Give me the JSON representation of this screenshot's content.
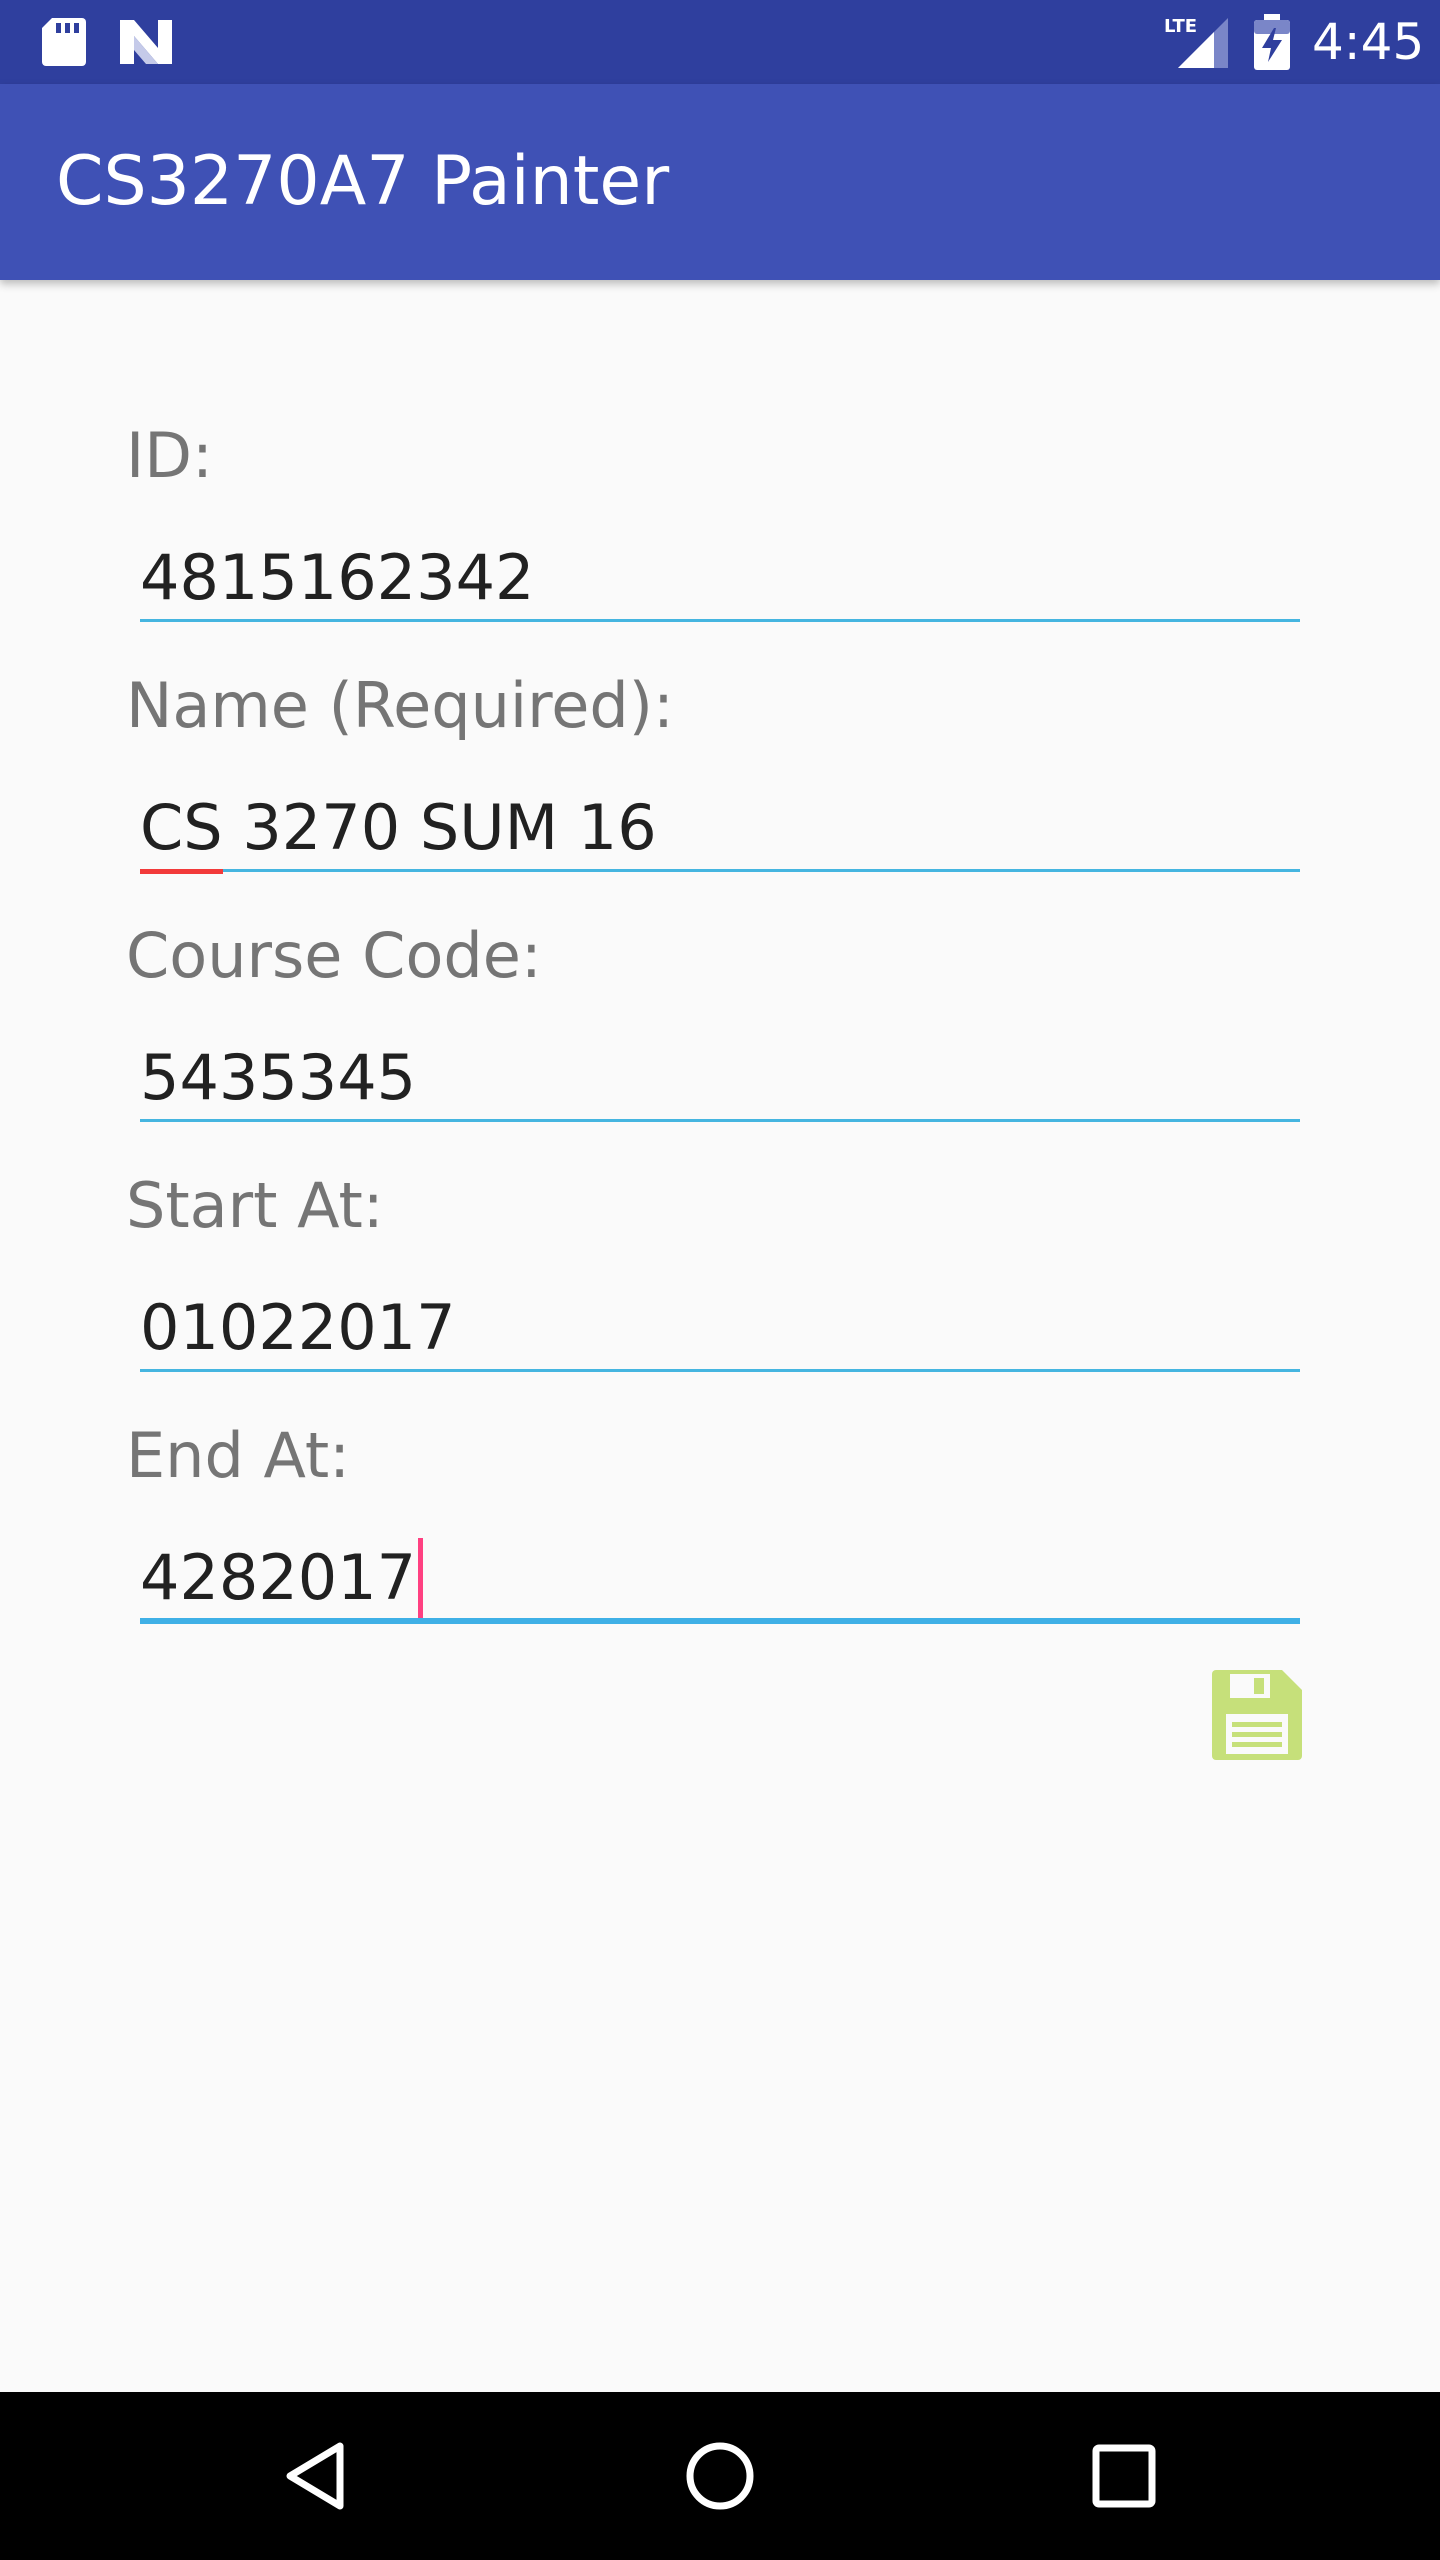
{
  "status_bar": {
    "time": "4:45",
    "left_icons": [
      "sd-card-icon",
      "n-logo-icon"
    ],
    "right_icons": [
      "lte-signal-icon",
      "battery-charging-icon"
    ],
    "network_label": "LTE"
  },
  "app_bar": {
    "title": "CS3270A7 Painter",
    "color": "#3f51b5"
  },
  "form": {
    "id": {
      "label": "ID:",
      "value": "4815162342"
    },
    "name": {
      "label": "Name (Required):",
      "value_underlined": "CS",
      "value_rest": " 3270 SUM 16"
    },
    "course_code": {
      "label": "Course Code:",
      "value": "5435345"
    },
    "start_at": {
      "label": "Start At:",
      "value": "01022017"
    },
    "end_at": {
      "label": "End At:",
      "value": "4282017"
    }
  },
  "save": {
    "icon": "save-floppy-icon",
    "color": "#c6e07a"
  },
  "nav_bar": {
    "icons": [
      "back-icon",
      "home-icon",
      "recents-icon"
    ]
  },
  "colors": {
    "accent": "#ff4081",
    "input_line": "#45b5e0",
    "status_bar": "#2f3f9e"
  }
}
